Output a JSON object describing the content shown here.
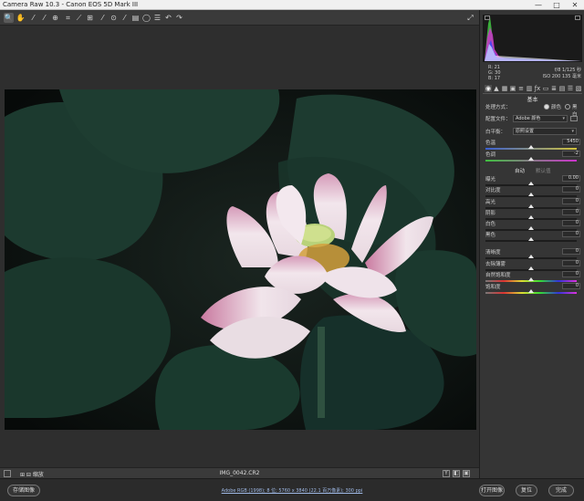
{
  "window": {
    "title": "Camera Raw 10.3 - Canon EOS 5D Mark III",
    "min_glyph": "—",
    "max_glyph": "□",
    "close_glyph": "✕"
  },
  "toolbar": {
    "tools": [
      {
        "name": "zoom-tool-icon",
        "glyph": "🔍"
      },
      {
        "name": "hand-tool-icon",
        "glyph": "✋"
      },
      {
        "name": "white-balance-tool-icon",
        "glyph": "⁄"
      },
      {
        "name": "color-sampler-tool-icon",
        "glyph": "⁄"
      },
      {
        "name": "targeted-adjustment-tool-icon",
        "glyph": "⊕"
      },
      {
        "name": "crop-tool-icon",
        "glyph": "⌗"
      },
      {
        "name": "straighten-tool-icon",
        "glyph": "⟋"
      },
      {
        "name": "transform-tool-icon",
        "glyph": "⊞"
      },
      {
        "name": "spot-removal-tool-icon",
        "glyph": "⁄"
      },
      {
        "name": "red-eye-removal-icon",
        "glyph": "⊙"
      },
      {
        "name": "adjustment-brush-icon",
        "glyph": "⁄"
      },
      {
        "name": "graduated-filter-icon",
        "glyph": "▤"
      },
      {
        "name": "radial-filter-icon",
        "glyph": "◯"
      },
      {
        "name": "preferences-icon",
        "glyph": "☰"
      },
      {
        "name": "rotate-left-icon",
        "glyph": "↶"
      },
      {
        "name": "rotate-right-icon",
        "glyph": "↷"
      }
    ],
    "fullscreen_glyph": "⤢"
  },
  "histogram": {
    "readout_r": "R:    21",
    "readout_g": "G:    30",
    "readout_b": "B:    17",
    "camera_line1": "f/8    1/125 秒",
    "camera_line2": "ISO 200   135 毫米"
  },
  "panel_tabs": [
    "◉",
    "▲",
    "▦",
    "▣",
    "≡",
    "▥",
    "ƒx",
    "▭",
    "≣",
    "▤",
    "☰",
    "▧"
  ],
  "basic": {
    "section_title": "基本",
    "treatment_label": "处理方式：",
    "treatment_color": "颜色",
    "treatment_bw": "黑白",
    "profile_label": "配置文件：",
    "profile_value": "Adobe 颜色",
    "wb_label": "白平衡：",
    "wb_value": "原照设置",
    "temperature_label": "色温",
    "temperature_value": "5450",
    "tint_label": "色调",
    "tint_value": "-2",
    "auto_label": "自动",
    "default_label": "默认值",
    "exposure_label": "曝光",
    "exposure_value": "0.00",
    "contrast_label": "对比度",
    "contrast_value": "0",
    "highlights_label": "高光",
    "highlights_value": "0",
    "shadows_label": "阴影",
    "shadows_value": "0",
    "whites_label": "白色",
    "whites_value": "0",
    "blacks_label": "黑色",
    "blacks_value": "0",
    "clarity_label": "清晰度",
    "clarity_value": "0",
    "dehaze_label": "去除薄雾",
    "dehaze_value": "0",
    "vibrance_label": "自然饱和度",
    "vibrance_value": "0",
    "saturation_label": "饱和度",
    "saturation_value": "0"
  },
  "sliders": {
    "temperature": 0.5,
    "tint": 0.5,
    "exposure": 0.5,
    "contrast": 0.5,
    "highlights": 0.5,
    "shadows": 0.5,
    "whites": 0.5,
    "blacks": 0.5,
    "clarity": 0.5,
    "dehaze": 0.5,
    "vibrance": 0.5,
    "saturation": 0.5
  },
  "status": {
    "zoom": "⊞ ⊟ 缩放",
    "filename": "IMG_0042.CR2",
    "toggle_y": "Y",
    "toggle_b": "◧",
    "toggle_c": "▣"
  },
  "bottom": {
    "save_label": "存储图像",
    "workflow_text": "Adobe RGB (1998); 8 位; 5760 x 3840 (22.1 百万像素); 300 ppi",
    "open_label": "打开图像",
    "reset_label": "复位",
    "done_label": "完成"
  },
  "colors": {
    "accent": "#4a7fd6",
    "photo_dark": "#101412",
    "leaf_green": "#1f3a30",
    "petal_pink": "#e8b4cc"
  }
}
